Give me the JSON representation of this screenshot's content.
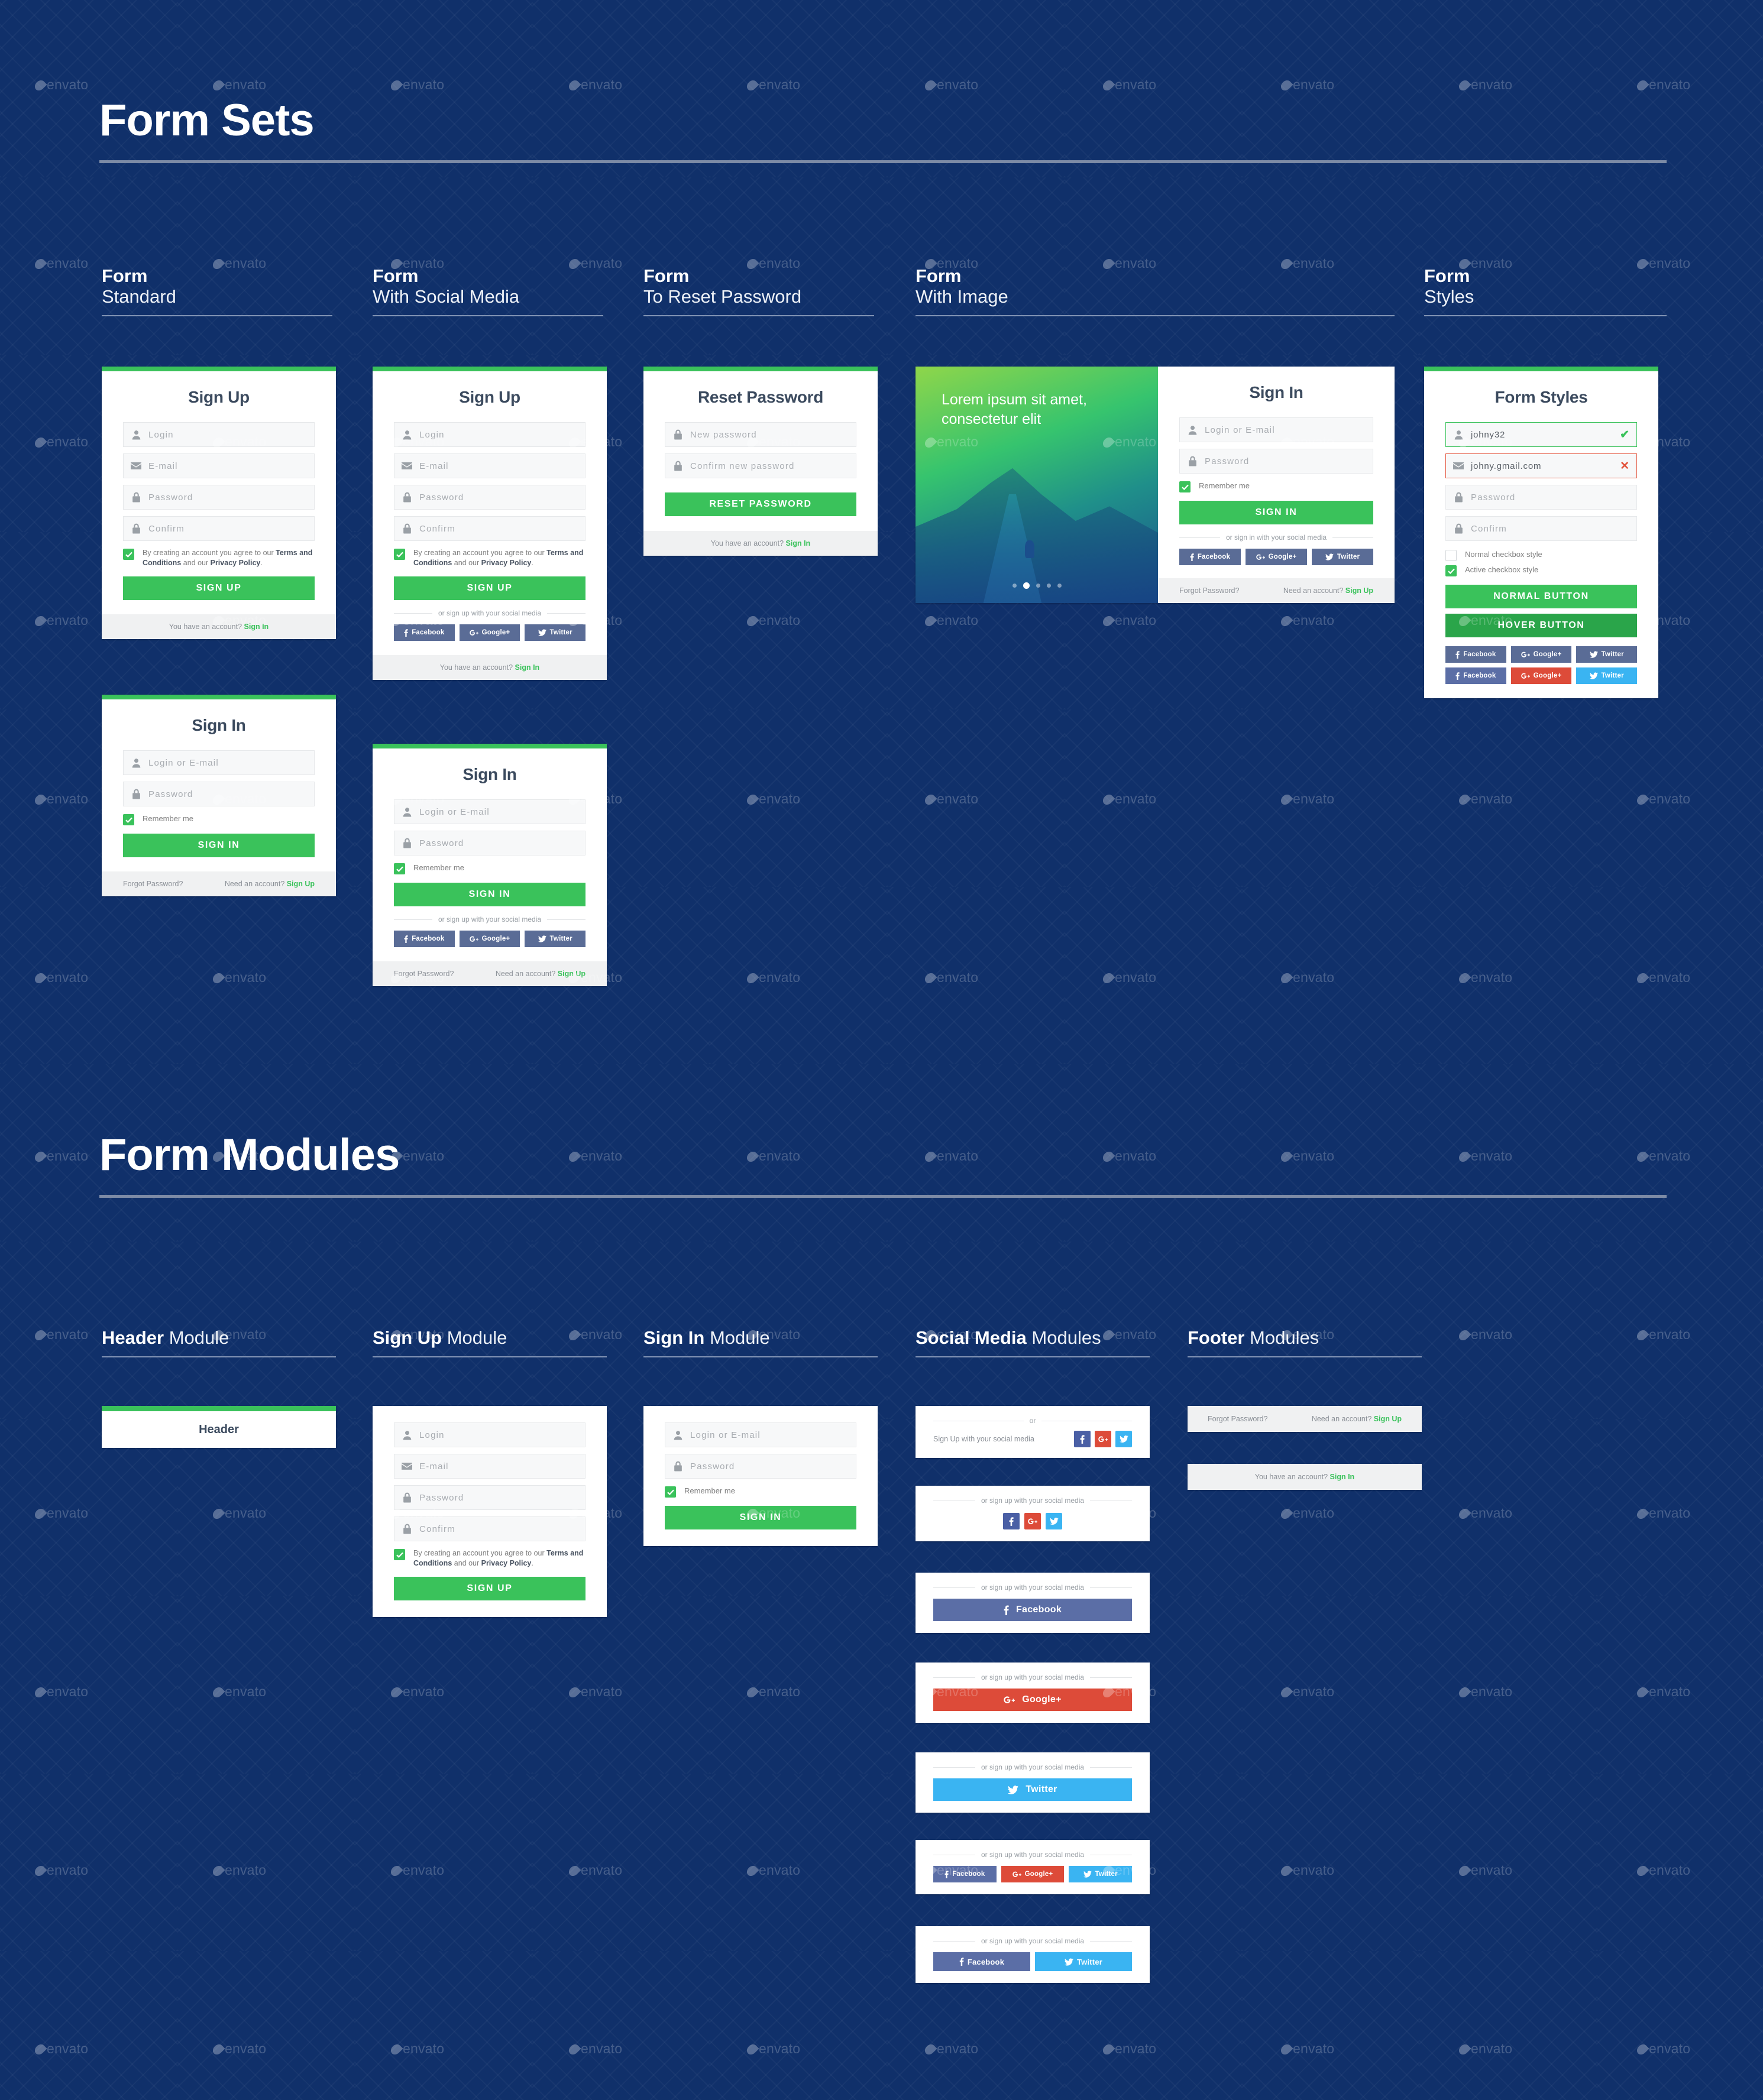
{
  "theme": {
    "background": "#10306a",
    "green": "#3ac25b",
    "green_hover": "#2aa54a",
    "facebook": "#5b6ea6",
    "google": "#dd4b39",
    "twitter": "#3ab4f2",
    "neutral_social": "#5a6c96",
    "error": "#e2523b",
    "heading": "#3b4a5e"
  },
  "sections": {
    "form_sets": "Form Sets",
    "form_modules": "Form Modules"
  },
  "column_headers": {
    "standard": {
      "bold": "Form",
      "light": "Standard"
    },
    "social": {
      "bold": "Form",
      "light": "With Social Media"
    },
    "reset": {
      "bold": "Form",
      "light": "To Reset Password"
    },
    "image": {
      "bold": "Form",
      "light": "With Image"
    },
    "styles": {
      "bold": "Form",
      "light": "Styles"
    },
    "header_module": {
      "bold": "Header",
      "light": " Module"
    },
    "signup_module": {
      "bold": "Sign Up",
      "light": " Module"
    },
    "signin_module": {
      "bold": "Sign In",
      "light": " Module"
    },
    "social_module": {
      "bold": "Social Media",
      "light": " Modules"
    },
    "footer_module": {
      "bold": "Footer",
      "light": " Modules"
    }
  },
  "labels": {
    "sign_up": "Sign Up",
    "sign_in": "Sign In",
    "reset_password_title": "Reset Password",
    "form_styles_title": "Form Styles",
    "header": "Header"
  },
  "placeholders": {
    "login": "Login",
    "email": "E-mail",
    "password": "Password",
    "confirm": "Confirm",
    "login_or_email": "Login or E-mail",
    "new_password": "New password",
    "confirm_new_password": "Confirm new password"
  },
  "values": {
    "username": "johny32",
    "email": "johny.gmail.com"
  },
  "checkboxes": {
    "terms_prefix": "By creating an account you agree to our ",
    "terms_bold": "Terms and Conditions",
    "terms_mid": " and our ",
    "privacy_bold": "Privacy Policy",
    "terms_suffix": ".",
    "remember_me": "Remember me",
    "normal_style": "Normal checkbox style",
    "active_style": "Active checkbox style"
  },
  "buttons": {
    "sign_up": "SIGN UP",
    "sign_in": "SIGN IN",
    "reset_password": "RESET PASSWORD",
    "normal": "NORMAL BUTTON",
    "hover": "HOVER BUTTON"
  },
  "dividers": {
    "or": "or",
    "sign_up_social": "or sign up with your social media",
    "sign_in_social": "or sign in with your social media"
  },
  "social": {
    "facebook": "Facebook",
    "google": "Google+",
    "twitter": "Twitter",
    "signup_with_label": "Sign Up with your social media"
  },
  "footers": {
    "have_account": "You have an account?",
    "sign_in_link": "Sign In",
    "forgot_password": "Forgot Password?",
    "need_account": "Need an account?",
    "sign_up_link": "Sign Up"
  },
  "hero": {
    "line1": "Lorem ipsum sit amet,",
    "line2": "consectetur elit",
    "dots_total": 5,
    "dots_active": 2
  },
  "watermark": {
    "text": "envato"
  }
}
